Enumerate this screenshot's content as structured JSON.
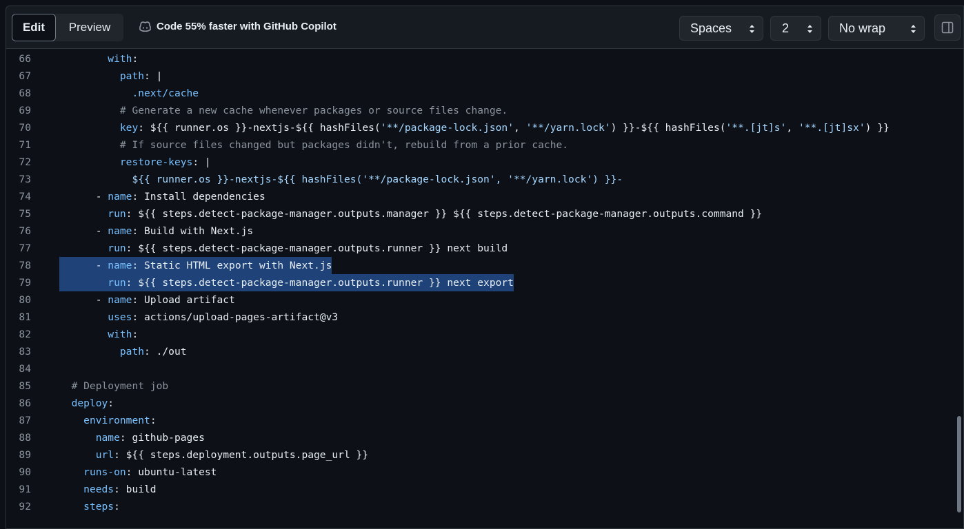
{
  "toolbar": {
    "edit_label": "Edit",
    "preview_label": "Preview",
    "copilot_text": "Code 55% faster with GitHub Copilot",
    "indent_mode": "Spaces",
    "indent_size": "2",
    "wrap_mode": "No wrap"
  },
  "selection": {
    "lines": [
      "78",
      "79"
    ],
    "color": "#1f4278"
  },
  "lines": [
    {
      "num": "66",
      "indent": "        ",
      "parts": [
        {
          "t": "with",
          "c": "kb"
        },
        {
          "t": ":"
        }
      ]
    },
    {
      "num": "67",
      "indent": "          ",
      "parts": [
        {
          "t": "path",
          "c": "kb"
        },
        {
          "t": ": |"
        }
      ]
    },
    {
      "num": "68",
      "indent": "            ",
      "parts": [
        {
          "t": ".next/cache",
          "c": "kb"
        }
      ]
    },
    {
      "num": "69",
      "indent": "          ",
      "parts": [
        {
          "t": "# Generate a new cache whenever packages or source files change.",
          "c": "c"
        }
      ]
    },
    {
      "num": "70",
      "indent": "          ",
      "parts": [
        {
          "t": "key",
          "c": "kb"
        },
        {
          "t": ": ${{ runner.os }}-nextjs-${{ hashFiles("
        },
        {
          "t": "'**/package-lock.json'",
          "c": "s"
        },
        {
          "t": ", "
        },
        {
          "t": "'**/yarn.lock'",
          "c": "s"
        },
        {
          "t": ") }}-${{ hashFiles("
        },
        {
          "t": "'**.[jt]s'",
          "c": "s"
        },
        {
          "t": ", "
        },
        {
          "t": "'**.[jt]sx'",
          "c": "s"
        },
        {
          "t": ") }}"
        }
      ]
    },
    {
      "num": "71",
      "indent": "          ",
      "parts": [
        {
          "t": "# If source files changed but packages didn't, rebuild from a prior cache.",
          "c": "c"
        }
      ]
    },
    {
      "num": "72",
      "indent": "          ",
      "parts": [
        {
          "t": "restore-keys",
          "c": "kb"
        },
        {
          "t": ": |"
        }
      ]
    },
    {
      "num": "73",
      "indent": "            ",
      "parts": [
        {
          "t": "${{ runner.os }}-nextjs-${{ hashFiles('**/package-lock.json', '**/yarn.lock') }}-",
          "c": "s"
        }
      ]
    },
    {
      "num": "74",
      "indent": "      ",
      "parts": [
        {
          "t": "- "
        },
        {
          "t": "name",
          "c": "kb"
        },
        {
          "t": ": Install dependencies"
        }
      ]
    },
    {
      "num": "75",
      "indent": "        ",
      "parts": [
        {
          "t": "run",
          "c": "kb"
        },
        {
          "t": ": ${{ steps.detect-package-manager.outputs.manager }} ${{ steps.detect-package-manager.outputs.command }}"
        }
      ]
    },
    {
      "num": "76",
      "indent": "      ",
      "parts": [
        {
          "t": "- "
        },
        {
          "t": "name",
          "c": "kb"
        },
        {
          "t": ": Build with Next.js"
        }
      ]
    },
    {
      "num": "77",
      "indent": "        ",
      "parts": [
        {
          "t": "run",
          "c": "kb"
        },
        {
          "t": ": ${{ steps.detect-package-manager.outputs.runner }} next build"
        }
      ]
    },
    {
      "num": "78",
      "indent": "      ",
      "parts": [
        {
          "t": "- "
        },
        {
          "t": "name",
          "c": "kb"
        },
        {
          "t": ": Static HTML export with Next.js"
        }
      ]
    },
    {
      "num": "79",
      "indent": "        ",
      "parts": [
        {
          "t": "run",
          "c": "kb"
        },
        {
          "t": ": ${{ steps.detect-package-manager.outputs.runner }} next export"
        }
      ]
    },
    {
      "num": "80",
      "indent": "      ",
      "parts": [
        {
          "t": "- "
        },
        {
          "t": "name",
          "c": "kb"
        },
        {
          "t": ": Upload artifact"
        }
      ]
    },
    {
      "num": "81",
      "indent": "        ",
      "parts": [
        {
          "t": "uses",
          "c": "kb"
        },
        {
          "t": ": actions/upload-pages-artifact@v3"
        }
      ]
    },
    {
      "num": "82",
      "indent": "        ",
      "parts": [
        {
          "t": "with",
          "c": "kb"
        },
        {
          "t": ":"
        }
      ]
    },
    {
      "num": "83",
      "indent": "          ",
      "parts": [
        {
          "t": "path",
          "c": "kb"
        },
        {
          "t": ": ./out"
        }
      ]
    },
    {
      "num": "84",
      "indent": "",
      "parts": []
    },
    {
      "num": "85",
      "indent": "  ",
      "parts": [
        {
          "t": "# Deployment job",
          "c": "c"
        }
      ]
    },
    {
      "num": "86",
      "indent": "  ",
      "parts": [
        {
          "t": "deploy",
          "c": "kb"
        },
        {
          "t": ":"
        }
      ]
    },
    {
      "num": "87",
      "indent": "    ",
      "parts": [
        {
          "t": "environment",
          "c": "kb"
        },
        {
          "t": ":"
        }
      ]
    },
    {
      "num": "88",
      "indent": "      ",
      "parts": [
        {
          "t": "name",
          "c": "kb"
        },
        {
          "t": ": github-pages"
        }
      ]
    },
    {
      "num": "89",
      "indent": "      ",
      "parts": [
        {
          "t": "url",
          "c": "kb"
        },
        {
          "t": ": ${{ steps.deployment.outputs.page_url }}"
        }
      ]
    },
    {
      "num": "90",
      "indent": "    ",
      "parts": [
        {
          "t": "runs-on",
          "c": "kb"
        },
        {
          "t": ": ubuntu-latest"
        }
      ]
    },
    {
      "num": "91",
      "indent": "    ",
      "parts": [
        {
          "t": "needs",
          "c": "kb"
        },
        {
          "t": ": build"
        }
      ]
    },
    {
      "num": "92",
      "indent": "    ",
      "parts": [
        {
          "t": "steps",
          "c": "kb"
        },
        {
          "t": ":"
        }
      ]
    }
  ]
}
